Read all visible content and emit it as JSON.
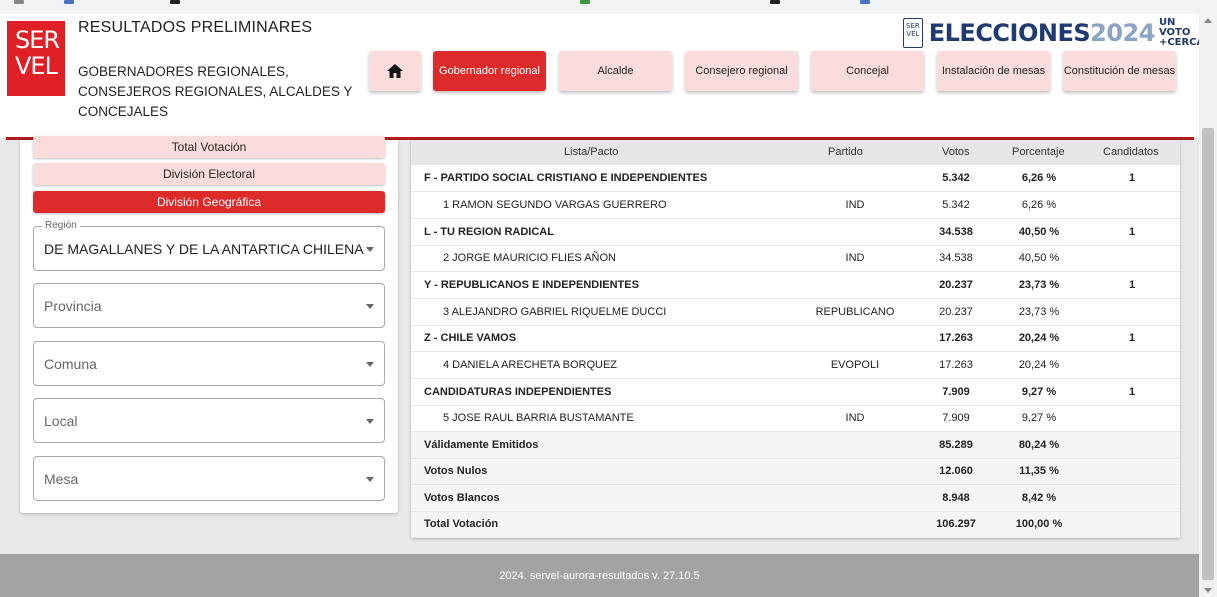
{
  "header": {
    "logo": {
      "line1": "SER",
      "line2": "VEL"
    },
    "title": "RESULTADOS PRELIMINARES",
    "subtitle": "GOBERNADORES REGIONALES, CONSEJEROS REGIONALES, ALCALDES Y CONCEJALES",
    "brand": {
      "badge": "SER VEL",
      "word": "ELECCIONES",
      "year": "2024",
      "tag_line1": "UN VOTO",
      "tag_line2": "+CERCA"
    },
    "nav": [
      {
        "label": "",
        "icon": "home-icon"
      },
      {
        "label": "Gobernador regional",
        "active": true
      },
      {
        "label": "Alcalde"
      },
      {
        "label": "Consejero regional"
      },
      {
        "label": "Concejal"
      },
      {
        "label": "Instalación de mesas"
      },
      {
        "label": "Constitución de mesas"
      }
    ]
  },
  "sidebar": {
    "buttons": [
      {
        "label": "Total Votación"
      },
      {
        "label": "División Electoral"
      },
      {
        "label": "División Geográfica",
        "active": true
      }
    ],
    "filters": [
      {
        "legend": "Región",
        "value": "DE MAGALLANES Y DE LA ANTARTICA CHILENA"
      },
      {
        "placeholder": "Provincia"
      },
      {
        "placeholder": "Comuna"
      },
      {
        "placeholder": "Local"
      },
      {
        "placeholder": "Mesa"
      }
    ]
  },
  "table": {
    "headers": {
      "lista": "Lista/Pacto",
      "partido": "Partido",
      "votos": "Votos",
      "porcentaje": "Porcentaje",
      "candidatos": "Candidatos"
    },
    "rows": [
      {
        "kind": "list",
        "name": "F - PARTIDO SOCIAL CRISTIANO E INDEPENDIENTES",
        "partido": "",
        "votos": "5.342",
        "porcentaje": "6,26 %",
        "candidatos": "1"
      },
      {
        "kind": "cand",
        "name": "1 RAMON SEGUNDO VARGAS GUERRERO",
        "partido": "IND",
        "votos": "5.342",
        "porcentaje": "6,26 %",
        "candidatos": ""
      },
      {
        "kind": "list",
        "name": "L - TU REGION RADICAL",
        "partido": "",
        "votos": "34.538",
        "porcentaje": "40,50 %",
        "candidatos": "1"
      },
      {
        "kind": "cand",
        "name": "2 JORGE MAURICIO FLIES AÑON",
        "partido": "IND",
        "votos": "34.538",
        "porcentaje": "40,50 %",
        "candidatos": ""
      },
      {
        "kind": "list",
        "name": "Y - REPUBLICANOS E INDEPENDIENTES",
        "partido": "",
        "votos": "20.237",
        "porcentaje": "23,73 %",
        "candidatos": "1"
      },
      {
        "kind": "cand",
        "name": "3 ALEJANDRO GABRIEL RIQUELME DUCCI",
        "partido": "REPUBLICANO",
        "votos": "20.237",
        "porcentaje": "23,73 %",
        "candidatos": ""
      },
      {
        "kind": "list",
        "name": "Z - CHILE VAMOS",
        "partido": "",
        "votos": "17.263",
        "porcentaje": "20,24 %",
        "candidatos": "1"
      },
      {
        "kind": "cand",
        "name": "4 DANIELA ARECHETA BORQUEZ",
        "partido": "EVOPOLI",
        "votos": "17.263",
        "porcentaje": "20,24 %",
        "candidatos": ""
      },
      {
        "kind": "list",
        "name": "CANDIDATURAS INDEPENDIENTES",
        "partido": "",
        "votos": "7.909",
        "porcentaje": "9,27 %",
        "candidatos": "1"
      },
      {
        "kind": "cand",
        "name": "5 JOSE RAUL BARRIA BUSTAMANTE",
        "partido": "IND",
        "votos": "7.909",
        "porcentaje": "9,27 %",
        "candidatos": ""
      },
      {
        "kind": "total",
        "name": "Válidamente Emitidos",
        "partido": "",
        "votos": "85.289",
        "porcentaje": "80,24 %",
        "candidatos": ""
      },
      {
        "kind": "total",
        "name": "Votos Nulos",
        "partido": "",
        "votos": "12.060",
        "porcentaje": "11,35 %",
        "candidatos": ""
      },
      {
        "kind": "total",
        "name": "Votos Blancos",
        "partido": "",
        "votos": "8.948",
        "porcentaje": "8,42 %",
        "candidatos": ""
      },
      {
        "kind": "total",
        "name": "Total Votación",
        "partido": "",
        "votos": "106.297",
        "porcentaje": "100,00 %",
        "candidatos": ""
      }
    ]
  },
  "footer": {
    "text": "2024. servel-aurora-resultados v. 27.10.5"
  },
  "colors": {
    "accent": "#dd2a2a",
    "button": "#fbdcdc",
    "brand_blue": "#1e3a6e",
    "footer": "#a3a3a3"
  }
}
